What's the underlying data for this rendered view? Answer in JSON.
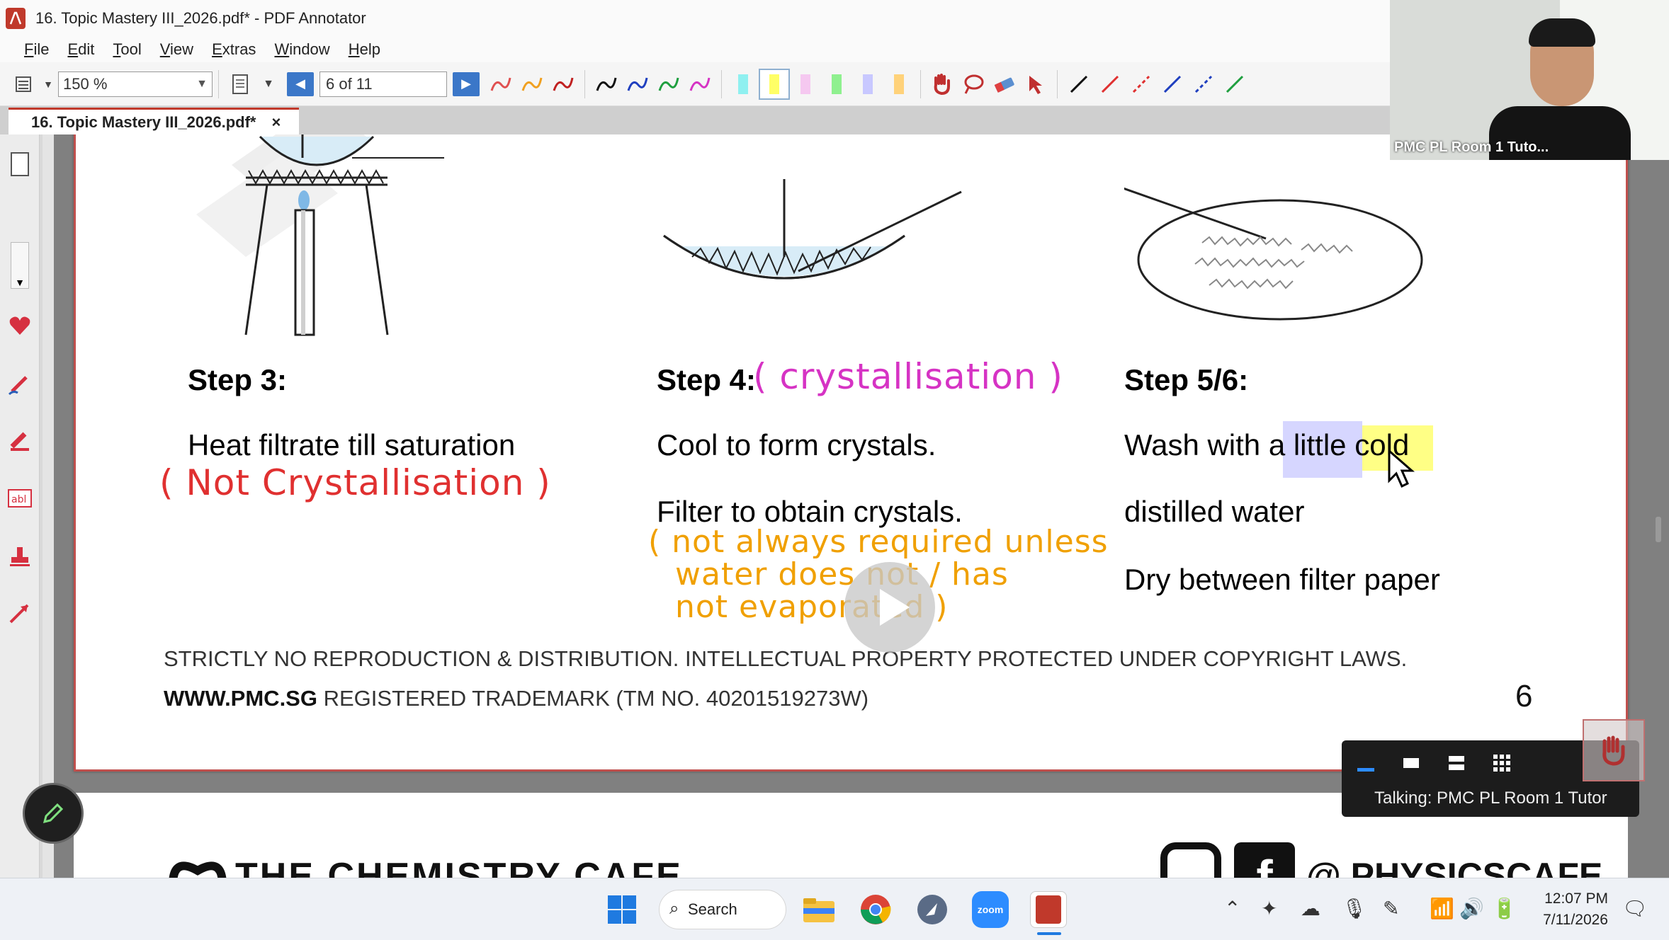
{
  "window": {
    "title": "16. Topic Mastery III_2026.pdf* - PDF Annotator"
  },
  "menu": [
    "File",
    "Edit",
    "Tool",
    "View",
    "Extras",
    "Window",
    "Help"
  ],
  "toolbar": {
    "zoom": "150 %",
    "page": "6 of 11"
  },
  "tab": {
    "label": "16. Topic Mastery III_2026.pdf*",
    "close": "×"
  },
  "page": {
    "step3": {
      "title": "Step 3:",
      "text": "Heat filtrate till saturation",
      "annotation": "( Not Crystallisation )"
    },
    "step4": {
      "title": "Step 4:",
      "annotation": "( crystallisation )",
      "line1": "Cool to form crystals.",
      "line2": "Filter to obtain crystals.",
      "note_line1": "( not always required unless",
      "note_line2": "water does not / has",
      "note_line3": "not evaporated )"
    },
    "step56": {
      "title": "Step 5/6:",
      "line1": "Wash with a little cold",
      "line2": "distilled water",
      "line3": "Dry between filter paper"
    },
    "copyright": "STRICTLY NO REPRODUCTION & DISTRIBUTION. INTELLECTUAL PROPERTY PROTECTED UNDER COPYRIGHT LAWS.",
    "trademark_site": "WWW.PMC.SG",
    "trademark_text": " REGISTERED TRADEMARK (TM NO. 40201519273W)",
    "page_number": "6",
    "footer_brand": "THE CHEMISTRY CAFE",
    "footer_social": "@ PHYSICSCAFE"
  },
  "webcam": {
    "name": "PMC PL Room 1 Tuto..."
  },
  "zoom": {
    "talking": "Talking: PMC PL Room 1 Tutor"
  },
  "taskbar": {
    "search": "Search",
    "zoom_label": "zoom",
    "time": "12:07 PM",
    "date": "7/11/2026"
  },
  "colors": {
    "annotation_magenta": "#d633c4",
    "annotation_red": "#e03030",
    "annotation_orange": "#f0a000",
    "highlight_yellow": "#ffff66",
    "highlight_lavender": "#c8c8ff",
    "page_border": "#c0504d"
  }
}
